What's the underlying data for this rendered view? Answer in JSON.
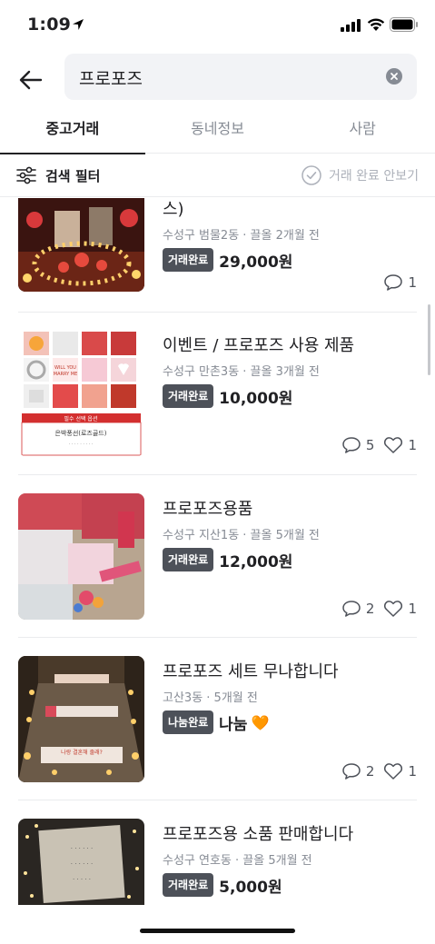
{
  "status_bar": {
    "time": "1:09"
  },
  "search": {
    "query": "프로포즈"
  },
  "tabs": [
    {
      "label": "중고거래"
    },
    {
      "label": "동네정보"
    },
    {
      "label": "사람"
    }
  ],
  "filter": {
    "label": "검색 필터",
    "hide_done_label": "거래 완료 안보기"
  },
  "items": [
    {
      "title": "스)",
      "meta": "수성구 범물2동 · 끌올 2개월 전",
      "badge": "거래완료",
      "price": "29,000원",
      "chats": "1",
      "likes": ""
    },
    {
      "title": "이벤트 / 프로포즈 사용 제품",
      "meta": "수성구 만촌3동 · 끌올 3개월 전",
      "badge": "거래완료",
      "price": "10,000원",
      "chats": "5",
      "likes": "1"
    },
    {
      "title": "프로포즈용품",
      "meta": "수성구 지산1동 · 끌올 5개월 전",
      "badge": "거래완료",
      "price": "12,000원",
      "chats": "2",
      "likes": "1"
    },
    {
      "title": "프로포즈 세트 무나합니다",
      "meta": "고산3동 · 5개월 전",
      "badge": "나눔완료",
      "price": "나눔",
      "heart_emoji": "🧡",
      "chats": "2",
      "likes": "1"
    },
    {
      "title": "프로포즈용 소품 판매합니다",
      "meta": "수성구 연호동 · 끌올 5개월 전",
      "badge": "거래완료",
      "price": "5,000원",
      "chats": "",
      "likes": ""
    }
  ],
  "colors": {
    "accent": "#ff6f0f",
    "badge_bg": "#4d5159",
    "muted_text": "#868b94"
  }
}
